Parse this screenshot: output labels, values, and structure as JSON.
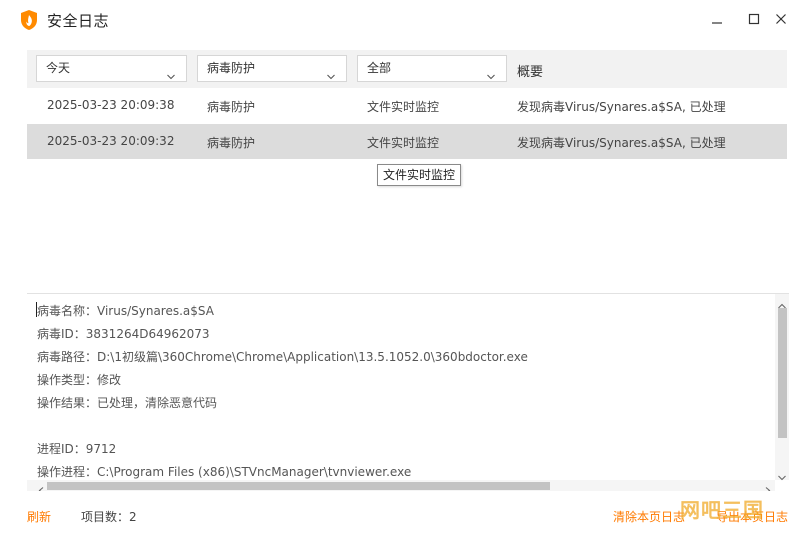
{
  "window": {
    "title": "安全日志"
  },
  "filters": {
    "date": "今天",
    "category": "病毒防护",
    "type": "全部",
    "summary_header": "概要"
  },
  "rows": [
    {
      "time": "2025-03-23 20:09:38",
      "category": "病毒防护",
      "type": "文件实时监控",
      "summary": "发现病毒Virus/Synares.a$SA, 已处理"
    },
    {
      "time": "2025-03-23 20:09:32",
      "category": "病毒防护",
      "type": "文件实时监控",
      "summary": "发现病毒Virus/Synares.a$SA, 已处理"
    }
  ],
  "tooltip": "文件实时监控",
  "detail": {
    "lines": [
      "病毒名称：Virus/Synares.a$SA",
      "病毒ID：3831264D64962073",
      "病毒路径：D:\\1初级篇\\360Chrome\\Chrome\\Application\\13.5.1052.0\\360bdoctor.exe",
      "操作类型：修改",
      "操作结果：已处理，清除恶意代码",
      "进程ID：9712",
      "操作进程：C:\\Program Files (x86)\\STVncManager\\tvnviewer.exe"
    ]
  },
  "footer": {
    "refresh": "刷新",
    "count_label": "项目数：2",
    "clear": "清除本页日志",
    "export": "导出本页日志",
    "watermark": "网吧三国"
  },
  "colors": {
    "accent": "#ff7a00",
    "selected_row": "#dcdcdc",
    "header_bg": "#f2f2f2"
  },
  "icons": {
    "app": "shield-flame-icon",
    "minimize": "minimize-icon",
    "maximize": "maximize-icon",
    "close": "close-icon"
  }
}
